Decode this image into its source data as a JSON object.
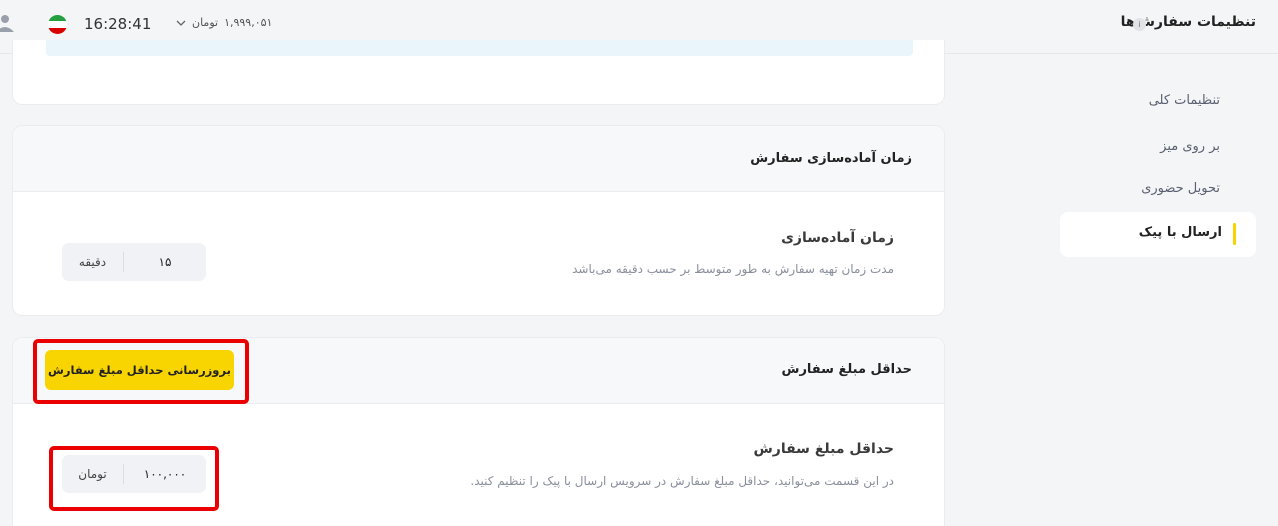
{
  "header": {
    "title": "تنظیمات سفارش‌ها",
    "info_icon": "i",
    "clock": "16:28:41",
    "balance_amount": "۱,۹۹۹,۰۵۱",
    "balance_unit": "تومان"
  },
  "sidebar": {
    "items": [
      {
        "label": "تنظیمات کلی"
      },
      {
        "label": "بر روی میز"
      },
      {
        "label": "تحویل حضوری"
      },
      {
        "label": "ارسال با پیک",
        "active": true
      }
    ]
  },
  "prep_card": {
    "title": "زمان آماده‌سازی سفارش",
    "row_title": "زمان آماده‌سازی",
    "row_desc": "مدت زمان تهیه سفارش به طور متوسط بر حسب دقیقه می‌باشد",
    "value": "۱۵",
    "unit": "دقیقه"
  },
  "min_order_card": {
    "title": "حداقل مبلغ سفارش",
    "update_button": "بروزرسانی حداقل مبلغ سفارش",
    "row_title": "حداقل مبلغ سفارش",
    "row_desc": "در این قسمت می‌توانید، حداقل مبلغ سفارش در سرویس ارسال با پیک را تنظیم کنید.",
    "value": "۱۰۰,۰۰۰",
    "unit": "تومان"
  },
  "colors": {
    "accent": "#f8d500",
    "highlight": "#ea0000",
    "info_strip": "#e9f5fb"
  }
}
